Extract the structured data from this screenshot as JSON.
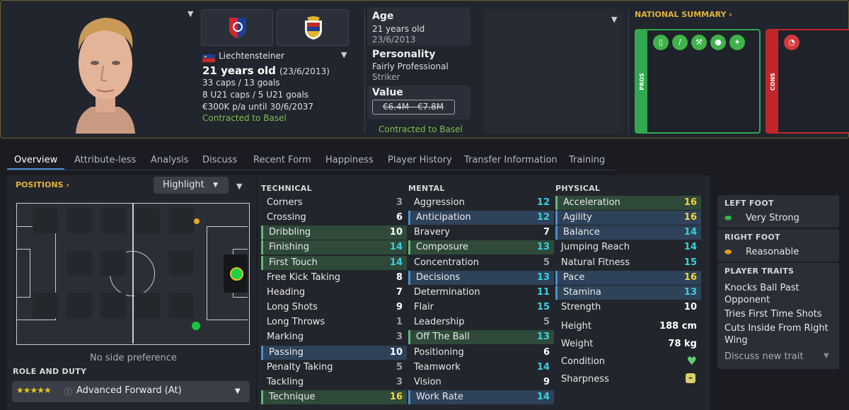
{
  "header": {
    "nationality": "Liechtensteiner",
    "age_line": "21 years old",
    "dob_paren": "(23/6/2013)",
    "caps": "33 caps / 13 goals",
    "u21": "8 U21 caps / 5 U21 goals",
    "contract": "€300K p/a until 30/6/2037",
    "club_line": "Contracted to Basel",
    "age_label": "Age",
    "age_value": "21 years old",
    "age_date": "23/6/2013",
    "personality_label": "Personality",
    "personality_value": "Fairly Professional",
    "role_text": "Striker",
    "value_label": "Value",
    "value_range": "€6.4M - €7.8M",
    "value_contract": "Contracted to Basel",
    "national_summary": "NATIONAL SUMMARY",
    "pros": "PROS",
    "cons": "CONS"
  },
  "tabs": [
    "Overview",
    "Attribute-less",
    "Analysis",
    "Discuss",
    "Recent Form",
    "Happiness",
    "Player History",
    "Transfer Information",
    "Training"
  ],
  "positions": {
    "title": "POSITIONS",
    "highlight": "Highlight",
    "side_pref": "No side preference",
    "role_title": "ROLE AND DUTY",
    "role_value": "Advanced Forward (At)"
  },
  "technical": {
    "title": "TECHNICAL",
    "rows": [
      {
        "name": "Corners",
        "value": "3"
      },
      {
        "name": "Crossing",
        "value": "6"
      },
      {
        "name": "Dribbling",
        "value": "10"
      },
      {
        "name": "Finishing",
        "value": "14"
      },
      {
        "name": "First Touch",
        "value": "14"
      },
      {
        "name": "Free Kick Taking",
        "value": "8"
      },
      {
        "name": "Heading",
        "value": "7"
      },
      {
        "name": "Long Shots",
        "value": "9"
      },
      {
        "name": "Long Throws",
        "value": "1"
      },
      {
        "name": "Marking",
        "value": "3"
      },
      {
        "name": "Passing",
        "value": "10"
      },
      {
        "name": "Penalty Taking",
        "value": "5"
      },
      {
        "name": "Tackling",
        "value": "3"
      },
      {
        "name": "Technique",
        "value": "16"
      }
    ]
  },
  "mental": {
    "title": "MENTAL",
    "rows": [
      {
        "name": "Aggression",
        "value": "12"
      },
      {
        "name": "Anticipation",
        "value": "12"
      },
      {
        "name": "Bravery",
        "value": "7"
      },
      {
        "name": "Composure",
        "value": "13"
      },
      {
        "name": "Concentration",
        "value": "5"
      },
      {
        "name": "Decisions",
        "value": "13"
      },
      {
        "name": "Determination",
        "value": "11"
      },
      {
        "name": "Flair",
        "value": "15"
      },
      {
        "name": "Leadership",
        "value": "5"
      },
      {
        "name": "Off The Ball",
        "value": "13"
      },
      {
        "name": "Positioning",
        "value": "6"
      },
      {
        "name": "Teamwork",
        "value": "14"
      },
      {
        "name": "Vision",
        "value": "9"
      },
      {
        "name": "Work Rate",
        "value": "14"
      }
    ]
  },
  "physical": {
    "title": "PHYSICAL",
    "rows": [
      {
        "name": "Acceleration",
        "value": "16"
      },
      {
        "name": "Agility",
        "value": "16"
      },
      {
        "name": "Balance",
        "value": "14"
      },
      {
        "name": "Jumping Reach",
        "value": "14"
      },
      {
        "name": "Natural Fitness",
        "value": "15"
      },
      {
        "name": "Pace",
        "value": "16"
      },
      {
        "name": "Stamina",
        "value": "13"
      },
      {
        "name": "Strength",
        "value": "10"
      }
    ],
    "height_label": "Height",
    "height_value": "188 cm",
    "weight_label": "Weight",
    "weight_value": "78 kg",
    "condition_label": "Condition",
    "sharpness_label": "Sharpness"
  },
  "right": {
    "left_foot_title": "LEFT FOOT",
    "left_foot_value": "Very Strong",
    "right_foot_title": "RIGHT FOOT",
    "right_foot_value": "Reasonable",
    "traits_title": "PLAYER TRAITS",
    "trait1": "Knocks Ball Past Opponent",
    "trait2": "Tries First Time Shots",
    "trait3": "Cuts Inside From Right Wing",
    "discuss": "Discuss new trait"
  },
  "colors": {
    "accent": "#e2b33a",
    "pros": "#2fa84f",
    "cons": "#c2262b",
    "highlight_blue": "#2e4259",
    "highlight_green": "#2f4a39"
  }
}
